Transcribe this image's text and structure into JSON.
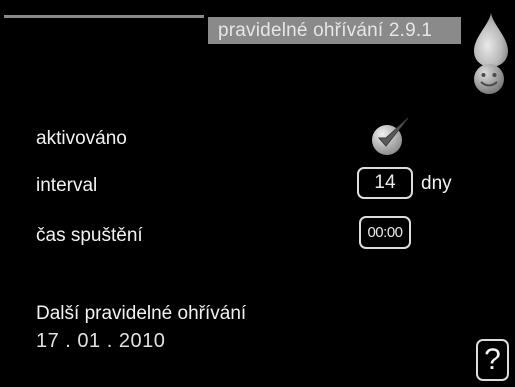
{
  "header": {
    "title": "pravidelné ohřívání  2.9.1"
  },
  "icons": {
    "top_right": "drop-icon",
    "below_drop": "smiley-icon",
    "active_state": "check-icon"
  },
  "settings": {
    "activated_label": "aktivováno",
    "activated_checked": true,
    "interval_label": "interval",
    "interval_value": "14",
    "interval_unit": "dny",
    "start_time_label": "čas spuštění",
    "start_time_value": "00:00"
  },
  "next": {
    "label": "Další pravidelné ohřívání",
    "date": "17 . 01 . 2010"
  },
  "help": {
    "label": "?"
  },
  "colors": {
    "background": "#000000",
    "title_bar": "#8a8a8a",
    "text": "#f2f2f2"
  }
}
